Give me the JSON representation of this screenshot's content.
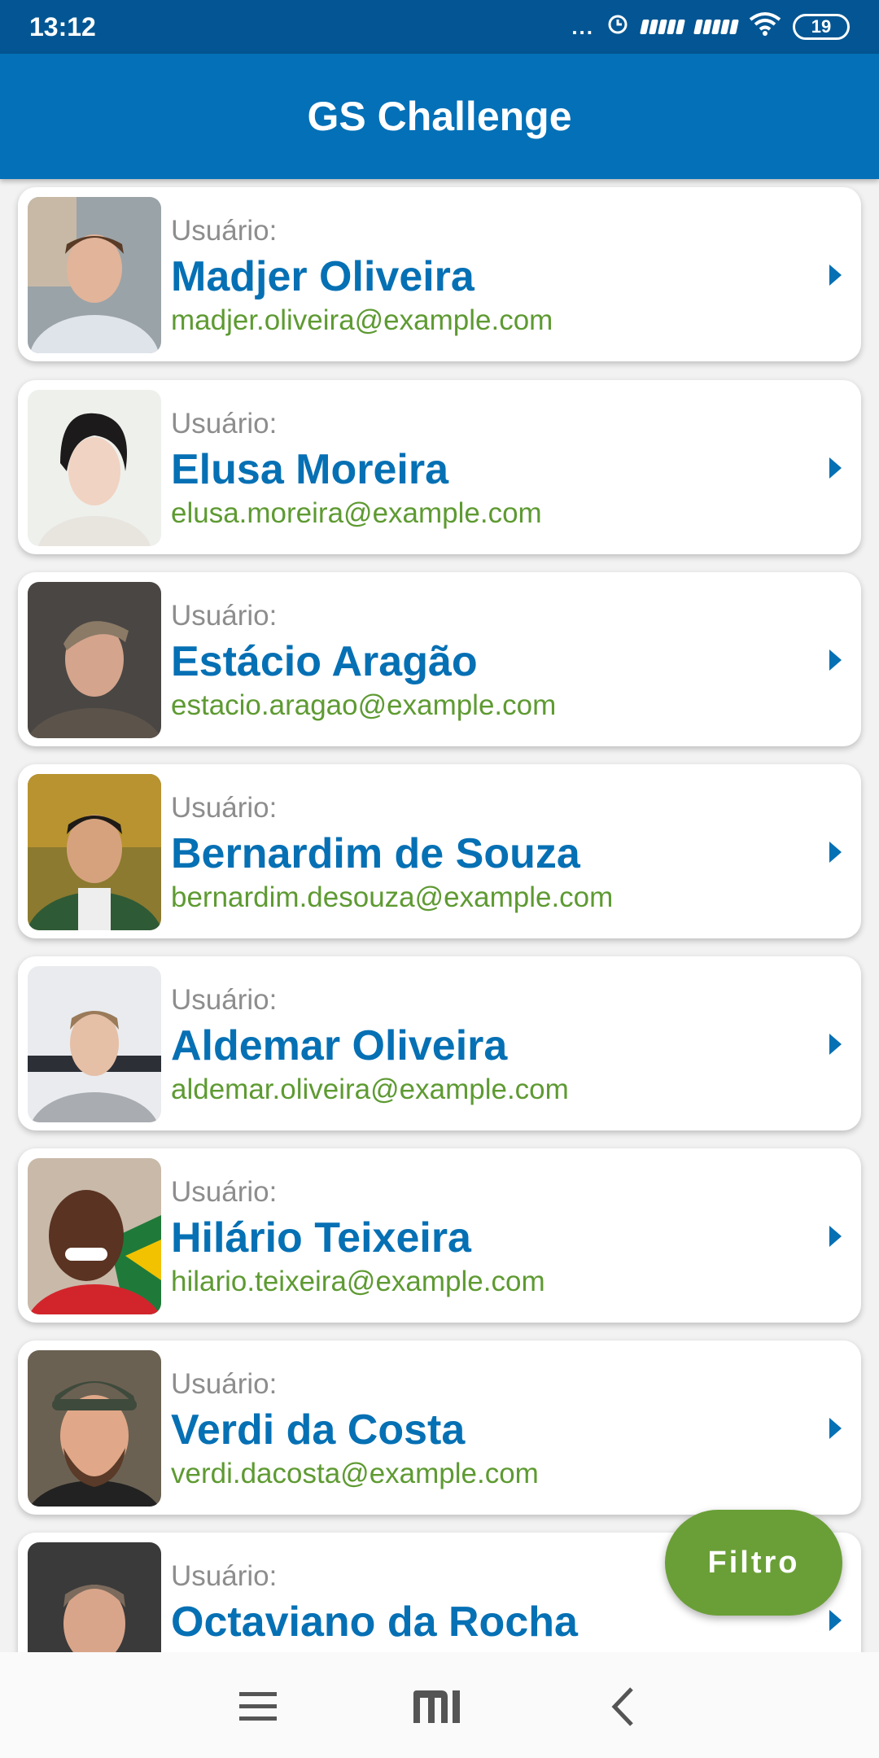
{
  "status": {
    "time": "13:12",
    "dots": "...",
    "battery": "19"
  },
  "app": {
    "title": "GS Challenge"
  },
  "users": [
    {
      "label": "Usuário:",
      "name": "Madjer Oliveira",
      "email": "madjer.oliveira@example.com"
    },
    {
      "label": "Usuário:",
      "name": "Elusa Moreira",
      "email": "elusa.moreira@example.com"
    },
    {
      "label": "Usuário:",
      "name": "Estácio Aragão",
      "email": "estacio.aragao@example.com"
    },
    {
      "label": "Usuário:",
      "name": "Bernardim de Souza",
      "email": "bernardim.desouza@example.com"
    },
    {
      "label": "Usuário:",
      "name": "Aldemar Oliveira",
      "email": "aldemar.oliveira@example.com"
    },
    {
      "label": "Usuário:",
      "name": "Hilário Teixeira",
      "email": "hilario.teixeira@example.com"
    },
    {
      "label": "Usuário:",
      "name": "Verdi da Costa",
      "email": "verdi.dacosta@example.com"
    },
    {
      "label": "Usuário:",
      "name": "Octaviano da Rocha",
      "email": ""
    }
  ],
  "fab": {
    "label": "Filtro"
  },
  "nav": {
    "menu_icon": "menu-icon",
    "home_icon": "mi-home-icon",
    "back_icon": "back-icon"
  },
  "colors": {
    "status_bar": "#035693",
    "app_bar": "#0370b7",
    "name_text": "#0670b4",
    "email_text": "#5e9a32",
    "fab": "#6a9f37"
  }
}
